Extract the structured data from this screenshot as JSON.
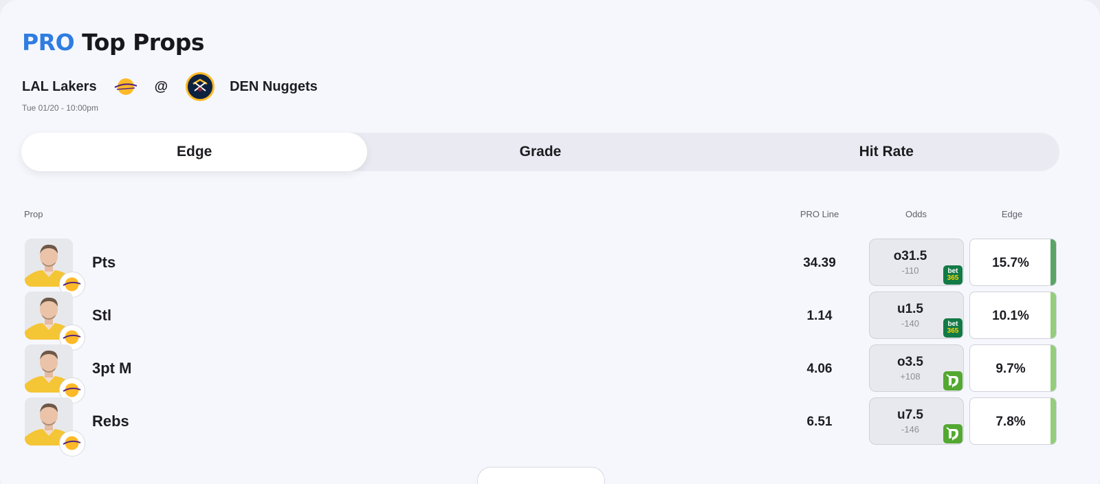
{
  "header": {
    "title_pro": "PRO",
    "title_rest": "Top Props"
  },
  "matchup": {
    "away_team": "LAL Lakers",
    "at": "@",
    "home_team": "DEN Nuggets",
    "datetime": "Tue 01/20 - 10:00pm",
    "away_logo_icon": "lakers-logo-icon",
    "home_logo_icon": "nuggets-logo-icon"
  },
  "tabs": [
    {
      "label": "Edge",
      "active": true
    },
    {
      "label": "Grade",
      "active": false
    },
    {
      "label": "Hit Rate",
      "active": false
    }
  ],
  "columns": {
    "prop": "Prop",
    "pro_line": "PRO Line",
    "odds": "Odds",
    "edge": "Edge"
  },
  "rows": [
    {
      "prop": "Pts",
      "pro_line": "34.39",
      "odds_line": "o31.5",
      "odds_price": "-110",
      "book": "bet365",
      "edge": "15.7%",
      "edge_color": "#5aa466"
    },
    {
      "prop": "Stl",
      "pro_line": "1.14",
      "odds_line": "u1.5",
      "odds_price": "-140",
      "book": "bet365",
      "edge": "10.1%",
      "edge_color": "#94cd7c"
    },
    {
      "prop": "3pt M",
      "pro_line": "4.06",
      "odds_line": "o3.5",
      "odds_price": "+108",
      "book": "draftkings",
      "edge": "9.7%",
      "edge_color": "#94cd7c"
    },
    {
      "prop": "Rebs",
      "pro_line": "6.51",
      "odds_line": "u7.5",
      "odds_price": "-146",
      "book": "draftkings",
      "edge": "7.8%",
      "edge_color": "#94cd7c"
    }
  ],
  "books": {
    "bet365_top": "bet",
    "bet365_bottom": "365"
  },
  "colors": {
    "accent": "#2f7de1"
  }
}
